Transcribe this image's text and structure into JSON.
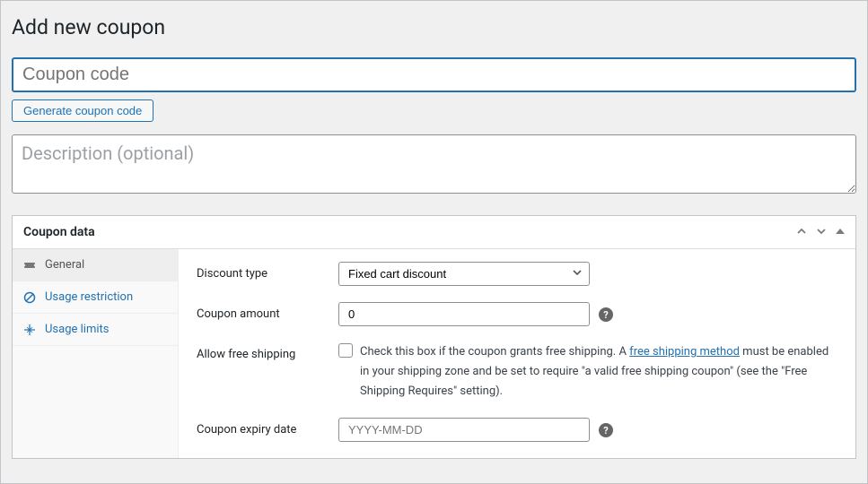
{
  "pageTitle": "Add new coupon",
  "couponCodePlaceholder": "Coupon code",
  "generateButtonLabel": "Generate coupon code",
  "descriptionPlaceholder": "Description (optional)",
  "panel": {
    "title": "Coupon data",
    "sidebar": {
      "general": "General",
      "usageRestriction": "Usage restriction",
      "usageLimits": "Usage limits"
    },
    "fields": {
      "discountType": {
        "label": "Discount type",
        "value": "Fixed cart discount"
      },
      "couponAmount": {
        "label": "Coupon amount",
        "value": "0"
      },
      "freeShipping": {
        "label": "Allow free shipping",
        "textBefore": "Check this box if the coupon grants free shipping. A ",
        "linkText": "free shipping method",
        "textAfter": " must be enabled in your shipping zone and be set to require \"a valid free shipping coupon\" (see the \"Free Shipping Requires\" setting)."
      },
      "expiryDate": {
        "label": "Coupon expiry date",
        "placeholder": "YYYY-MM-DD"
      }
    }
  }
}
